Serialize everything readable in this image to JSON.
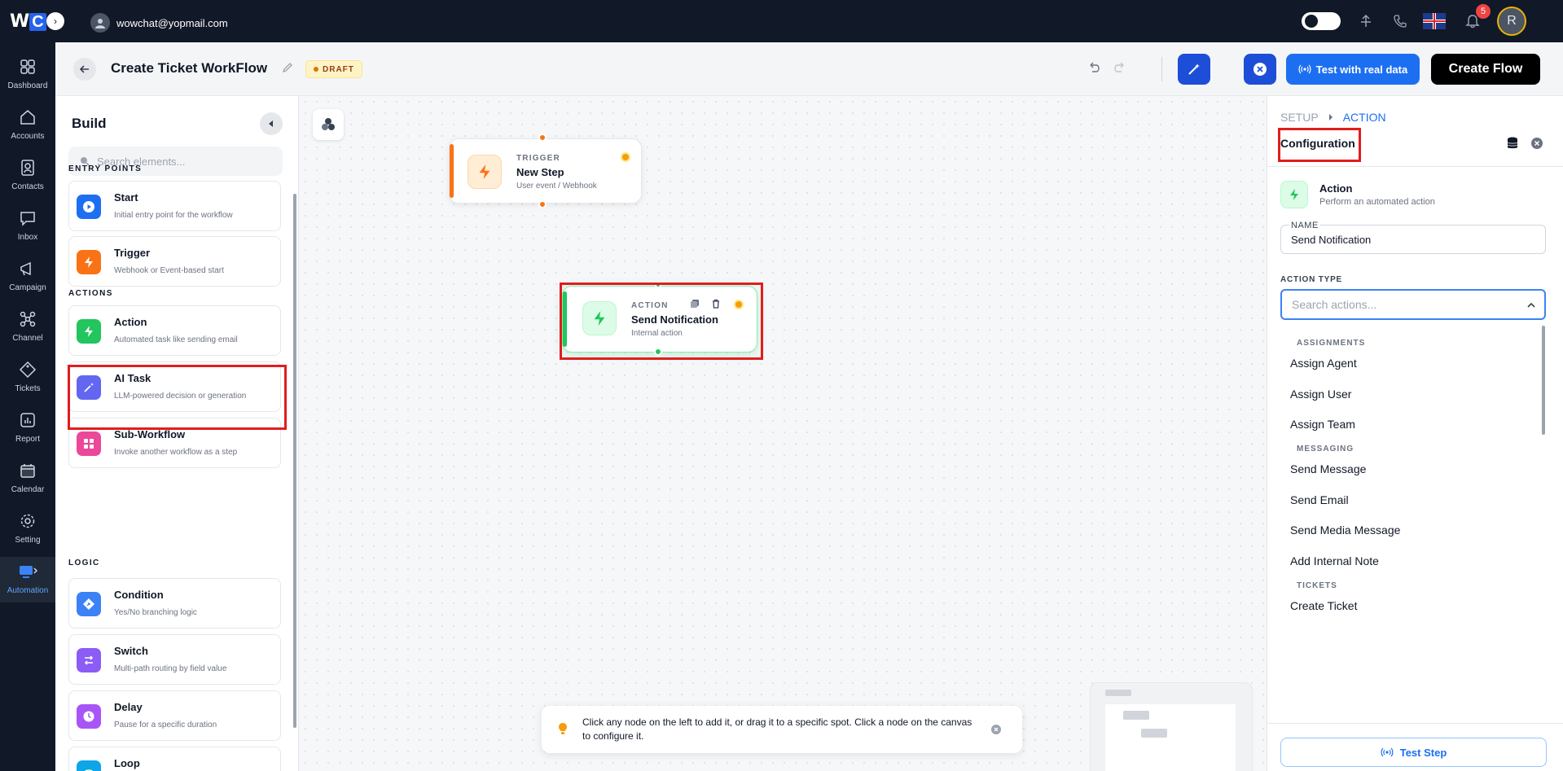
{
  "topbar": {
    "logo_w": "W",
    "logo_c": "C",
    "user_email": "wowchat@yopmail.com",
    "notification_count": "5",
    "avatar_initial": "R"
  },
  "nav": [
    {
      "label": "Dashboard",
      "icon": "dashboard-icon"
    },
    {
      "label": "Accounts",
      "icon": "home-icon"
    },
    {
      "label": "Contacts",
      "icon": "contacts-icon"
    },
    {
      "label": "Inbox",
      "icon": "inbox-icon"
    },
    {
      "label": "Campaign",
      "icon": "megaphone-icon"
    },
    {
      "label": "Channel",
      "icon": "network-icon"
    },
    {
      "label": "Tickets",
      "icon": "ticket-icon"
    },
    {
      "label": "Report",
      "icon": "report-icon"
    },
    {
      "label": "Calendar",
      "icon": "calendar-icon"
    },
    {
      "label": "Setting",
      "icon": "gear-icon"
    },
    {
      "label": "Automation",
      "icon": "automation-icon",
      "active": true
    }
  ],
  "header": {
    "title": "Create Ticket WorkFlow",
    "status": "DRAFT",
    "test_real_label": "Test with real data",
    "create_flow_label": "Create Flow"
  },
  "build": {
    "title": "Build",
    "search_placeholder": "Search elements...",
    "sections": {
      "entry_points": "ENTRY POINTS",
      "actions": "ACTIONS",
      "logic": "LOGIC"
    },
    "entry_points": [
      {
        "name": "Start",
        "desc": "Initial entry point for the workflow",
        "color": "#1d6ff2"
      },
      {
        "name": "Trigger",
        "desc": "Webhook or Event-based start",
        "color": "#f97316"
      }
    ],
    "actions": [
      {
        "name": "Action",
        "desc": "Automated task like sending email",
        "color": "#22c55e"
      },
      {
        "name": "AI Task",
        "desc": "LLM-powered decision or generation",
        "color": "#6366f1"
      },
      {
        "name": "Sub-Workflow",
        "desc": "Invoke another workflow as a step",
        "color": "#ec4899"
      }
    ],
    "logic": [
      {
        "name": "Condition",
        "desc": "Yes/No branching logic",
        "color": "#3b82f6"
      },
      {
        "name": "Switch",
        "desc": "Multi-path routing by field value",
        "color": "#8b5cf6"
      },
      {
        "name": "Delay",
        "desc": "Pause for a specific duration",
        "color": "#a855f7"
      },
      {
        "name": "Loop",
        "desc": "",
        "color": "#0ea5e9"
      }
    ]
  },
  "canvas": {
    "trigger_node": {
      "type": "TRIGGER",
      "name": "New Step",
      "sub": "User event / Webhook"
    },
    "action_node": {
      "type": "ACTION",
      "name": "Send Notification",
      "sub": "Internal action"
    },
    "hint": "Click any node on the left to add it, or drag it to a specific spot. Click a node on the canvas to configure it."
  },
  "config": {
    "crumb_setup": "SETUP",
    "crumb_action": "ACTION",
    "title": "Configuration",
    "action_name": "Action",
    "action_desc": "Perform an automated action",
    "name_label": "NAME",
    "name_value": "Send Notification",
    "action_type_label": "ACTION TYPE",
    "action_search_placeholder": "Search actions...",
    "groups": [
      {
        "label": "ASSIGNMENTS",
        "items": [
          "Assign Agent",
          "Assign User",
          "Assign Team"
        ]
      },
      {
        "label": "MESSAGING",
        "items": [
          "Send Message",
          "Send Email",
          "Send Media Message",
          "Add Internal Note"
        ]
      },
      {
        "label": "TICKETS",
        "items": [
          "Create Ticket"
        ]
      }
    ],
    "test_step_label": "Test Step"
  }
}
